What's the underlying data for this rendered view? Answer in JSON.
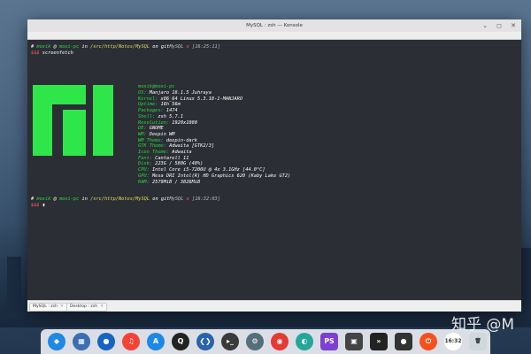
{
  "window": {
    "title": "MySQL : zsh — Konsole",
    "controls": [
      "⌄",
      "◻",
      "✕"
    ]
  },
  "terminal": {
    "prompt1": {
      "user": "moxik",
      "at": "@",
      "host": "moxi-pc",
      "in": "in",
      "path": "/src/http/Notes/MySQL",
      "on": "on",
      "git": "git",
      "branch": "MySQL",
      "mark": "x",
      "time": "[16:25:11]"
    },
    "command1": {
      "arrow": "$$$",
      "text": "screenfetch"
    },
    "info": {
      "header": "moxik@moxi-pc",
      "rows": [
        {
          "key": "OS:",
          "value": "Manjaro 18.1.5 Juhraya"
        },
        {
          "key": "Kernel:",
          "value": "x86_64 Linux 5.3.18-1-MANJARO"
        },
        {
          "key": "Uptime:",
          "value": "16h 56m"
        },
        {
          "key": "Packages:",
          "value": "1474"
        },
        {
          "key": "Shell:",
          "value": "zsh 5.7.1"
        },
        {
          "key": "Resolution:",
          "value": "1920x1080"
        },
        {
          "key": "DE:",
          "value": "GNOME"
        },
        {
          "key": "WM:",
          "value": "Deepin WM"
        },
        {
          "key": "WM Theme:",
          "value": "deepin-dark"
        },
        {
          "key": "GTK Theme:",
          "value": "Adwaita [GTK2/3]"
        },
        {
          "key": "Icon Theme:",
          "value": "Adwaita"
        },
        {
          "key": "Font:",
          "value": "Cantarell 11"
        },
        {
          "key": "Disk:",
          "value": "223G / 580G (40%)"
        },
        {
          "key": "CPU:",
          "value": "Intel Core i5-7200U @ 4x 3.1GHz [44.0°C]"
        },
        {
          "key": "GPU:",
          "value": "Mesa DRI Intel(R) HD Graphics 620 (Kaby Lake GT2)"
        },
        {
          "key": "RAM:",
          "value": "2579MiB / 3826MiB"
        }
      ]
    },
    "prompt2": {
      "user": "moxik",
      "at": "@",
      "host": "moxi-pc",
      "in": "in",
      "path": "/src/http/Notes/MySQL",
      "on": "on",
      "git": "git",
      "branch": "MySQL",
      "mark": "x",
      "time": "[16:32:03]"
    },
    "command2": {
      "arrow": "$$$",
      "cursor": "▮"
    }
  },
  "tabs": [
    {
      "label": "MySQL : zsh",
      "close": "✕"
    },
    {
      "label": "Desktop : zsh",
      "close": "✕"
    }
  ],
  "dock": {
    "items": [
      {
        "name": "launcher",
        "glyph": "◆",
        "color": "#1e88e5"
      },
      {
        "name": "multitask",
        "glyph": "▦",
        "color": "#3c6fb0"
      },
      {
        "name": "browser",
        "glyph": "●",
        "color": "#1565c0"
      },
      {
        "name": "music",
        "glyph": "♫",
        "color": "#f44336"
      },
      {
        "name": "appstore",
        "glyph": "A",
        "color": "#1e88e5"
      },
      {
        "name": "qq",
        "glyph": "Q",
        "color": "#222222"
      },
      {
        "name": "vscode",
        "glyph": "❮❯",
        "color": "#2962a8"
      },
      {
        "name": "terminal",
        "glyph": "▸_",
        "color": "#3a3a3a"
      },
      {
        "name": "settings",
        "glyph": "⚙",
        "color": "#546e7a"
      },
      {
        "name": "chrome",
        "glyph": "◉",
        "color": "#e53935"
      },
      {
        "name": "network",
        "glyph": "◐",
        "color": "#26a69a"
      },
      {
        "name": "phpstorm",
        "glyph": "PS",
        "color": "#7e3fd3"
      },
      {
        "name": "photos",
        "glyph": "▣",
        "color": "#444444"
      },
      {
        "name": "media",
        "glyph": "»",
        "color": "#222222"
      },
      {
        "name": "record",
        "glyph": "●",
        "color": "#333333"
      },
      {
        "name": "power",
        "glyph": "⏻",
        "color": "#f4511e"
      },
      {
        "name": "clock",
        "glyph": "16:32",
        "color": "#ffffff"
      },
      {
        "name": "trash",
        "glyph": "🗑",
        "color": "#cfd8dc"
      }
    ]
  },
  "watermark": "知乎 @M"
}
